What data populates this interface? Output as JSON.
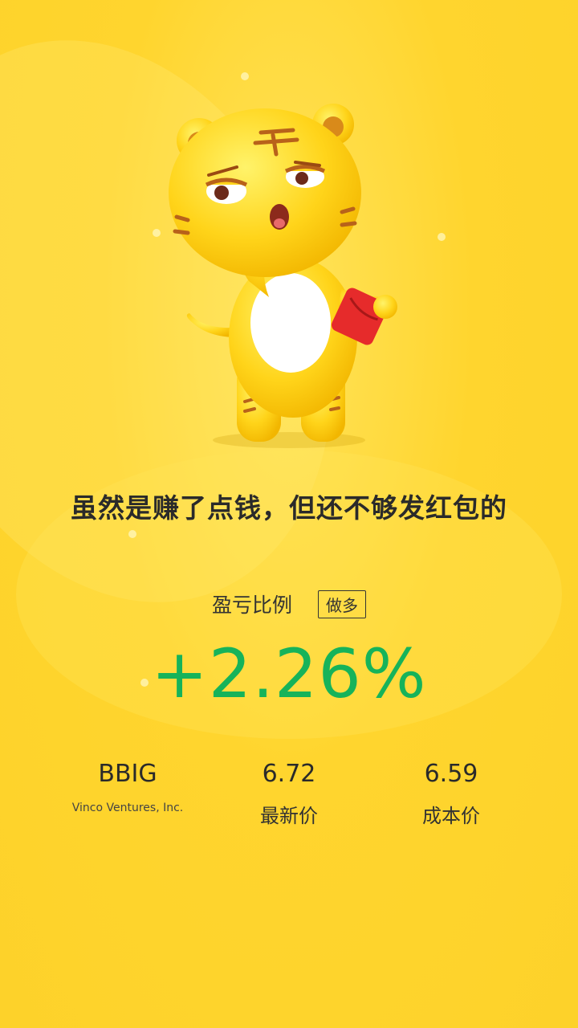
{
  "headline": "虽然是赚了点钱，但还不够发红包的",
  "ratio": {
    "label": "盈亏比例",
    "badge": "做多",
    "value": "+2.26%"
  },
  "stock": {
    "ticker": "BBIG",
    "name": "Vinco Ventures, Inc."
  },
  "latest": {
    "value": "6.72",
    "label": "最新价"
  },
  "cost": {
    "value": "6.59",
    "label": "成本价"
  },
  "colors": {
    "background": "#fdd22a",
    "profit": "#16b35a",
    "text": "#2a2a2a"
  },
  "mascot": {
    "icon": "tiger-mascot-icon",
    "prop": "red-envelope-icon"
  }
}
